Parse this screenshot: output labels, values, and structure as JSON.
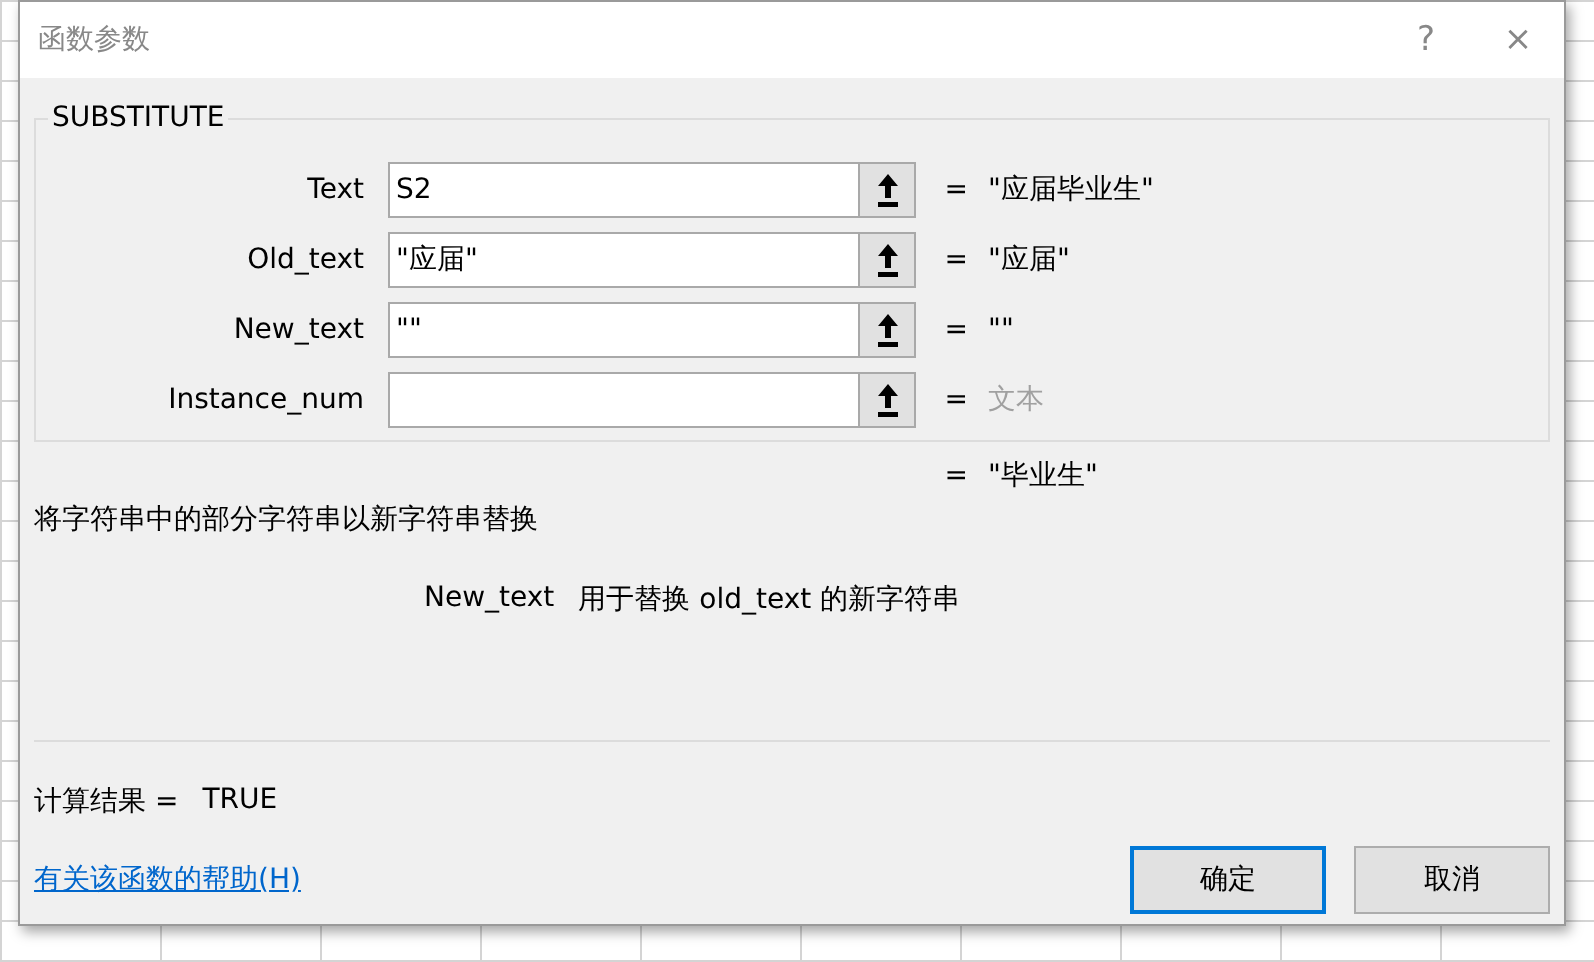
{
  "window": {
    "title": "函数参数",
    "help": "?",
    "close": "×"
  },
  "function_name": "SUBSTITUTE",
  "arguments": [
    {
      "label": "Text",
      "value": "S2",
      "equals": "=",
      "result": "\"应届毕业生\"",
      "dimmed": false
    },
    {
      "label": "Old_text",
      "value": "\"应届\"",
      "equals": "=",
      "result": "\"应届\"",
      "dimmed": false
    },
    {
      "label": "New_text",
      "value": "\"\"",
      "equals": "=",
      "result": "\"\"",
      "dimmed": false
    },
    {
      "label": "Instance_num",
      "equals": "=",
      "result": "文本",
      "dimmed": true
    }
  ],
  "formula_result": {
    "equals": "=",
    "value": "\"毕业生\""
  },
  "description": "将字符串中的部分字符串以新字符串替换",
  "argument_help": {
    "name": "New_text",
    "text": "用于替换 old_text 的新字符串"
  },
  "calc_result": {
    "label": "计算结果 =",
    "value": "TRUE"
  },
  "help_link": "有关该函数的帮助(H)",
  "buttons": [
    {
      "label": "确定",
      "selected": true
    },
    {
      "label": "取消",
      "selected": false
    }
  ]
}
